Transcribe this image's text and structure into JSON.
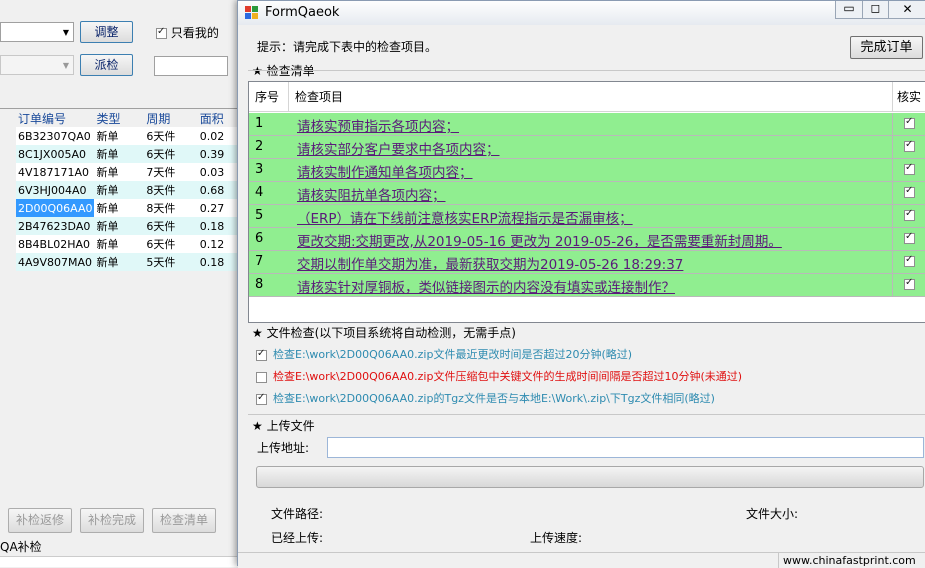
{
  "bg": {
    "adjust_btn": "调整",
    "dispatch_btn": "派检",
    "only_mine_label": "只看我的",
    "only_mine_checked": true,
    "columns": [
      "订单编号",
      "类型",
      "周期",
      "面积"
    ],
    "rows": [
      [
        "6B32307QA0",
        "新单",
        "6天件",
        "0.02"
      ],
      [
        "8C1JX005A0",
        "新单",
        "6天件",
        "0.39"
      ],
      [
        "4V187171A0",
        "新单",
        "7天件",
        "0.03"
      ],
      [
        "6V3HJ004A0",
        "新单",
        "8天件",
        "0.68"
      ],
      [
        "2D00Q06AA0",
        "新单",
        "8天件",
        "0.27"
      ],
      [
        "2B47623DA0",
        "新单",
        "6天件",
        "0.18"
      ],
      [
        "8B4BL02HA0",
        "新单",
        "6天件",
        "0.12"
      ],
      [
        "4A9V807MA0",
        "新单",
        "5天件",
        "0.18"
      ]
    ],
    "selected_row": 4,
    "btn_reinspect_return": "补检返修",
    "btn_reinspect_done": "补检完成",
    "btn_inspect_list": "检查清单",
    "qa_label": "QA补检"
  },
  "dialog": {
    "title": "FormQaeok",
    "hint": "提示：请完成下表中的检查项目。",
    "complete_btn": "完成订单",
    "checklist_title": "★ 检查清单",
    "col_no": "序号",
    "col_item": "检查项目",
    "col_check": "核实",
    "items": [
      {
        "no": "1",
        "text": "请核实预审指示各项内容；",
        "checked": true
      },
      {
        "no": "2",
        "text": "请核实部分客户要求中各项内容；",
        "checked": true
      },
      {
        "no": "3",
        "text": "请核实制作通知单各项内容；",
        "checked": true
      },
      {
        "no": "4",
        "text": "请核实阻抗单各项内容；",
        "checked": true
      },
      {
        "no": "5",
        "text": "（ERP）请在下线前注意核实ERP流程指示是否漏审核；",
        "checked": true
      },
      {
        "no": "6",
        "text": "更改交期:交期更改,从2019-05-16 更改为 2019-05-26，是否需要重新封周期。",
        "checked": true
      },
      {
        "no": "7",
        "text": "交期以制作单交期为准，最新获取交期为2019-05-26 18:29:37",
        "checked": true
      },
      {
        "no": "8",
        "text": "请核实针对厚铜板，类似链接图示的内容没有填实或连接制作？",
        "checked": true
      }
    ],
    "file_check_title": "★ 文件检查(以下项目系统将自动检测，无需手点)",
    "file_checks": [
      {
        "text": "检查E:\\work\\2D00Q06AA0.zip文件最近更改时间是否超过20分钟(略过)",
        "checked": true,
        "color": "#2e8bb0"
      },
      {
        "text": "检查E:\\work\\2D00Q06AA0.zip文件压缩包中关键文件的生成时间间隔是否超过10分钟(未通过)",
        "checked": false,
        "color": "#e01010"
      },
      {
        "text": "检查E:\\work\\2D00Q06AA0.zip的Tgz文件是否与本地E:\\Work\\.zip\\下Tgz文件相同(略过)",
        "checked": true,
        "color": "#2e8bb0"
      }
    ],
    "upload_title": "★ 上传文件",
    "upload_addr_label": "上传地址:",
    "upload_addr_value": "",
    "file_path_label": "文件路径:",
    "file_size_label": "文件大小:",
    "uploaded_label": "已经上传:",
    "upload_speed_label": "上传速度:",
    "status_text": "www.chinafastprint.com",
    "progress": 0
  },
  "colors": {
    "row_green": "#90ee90",
    "link": "#5a1a7a",
    "selected": "#3399ff"
  }
}
